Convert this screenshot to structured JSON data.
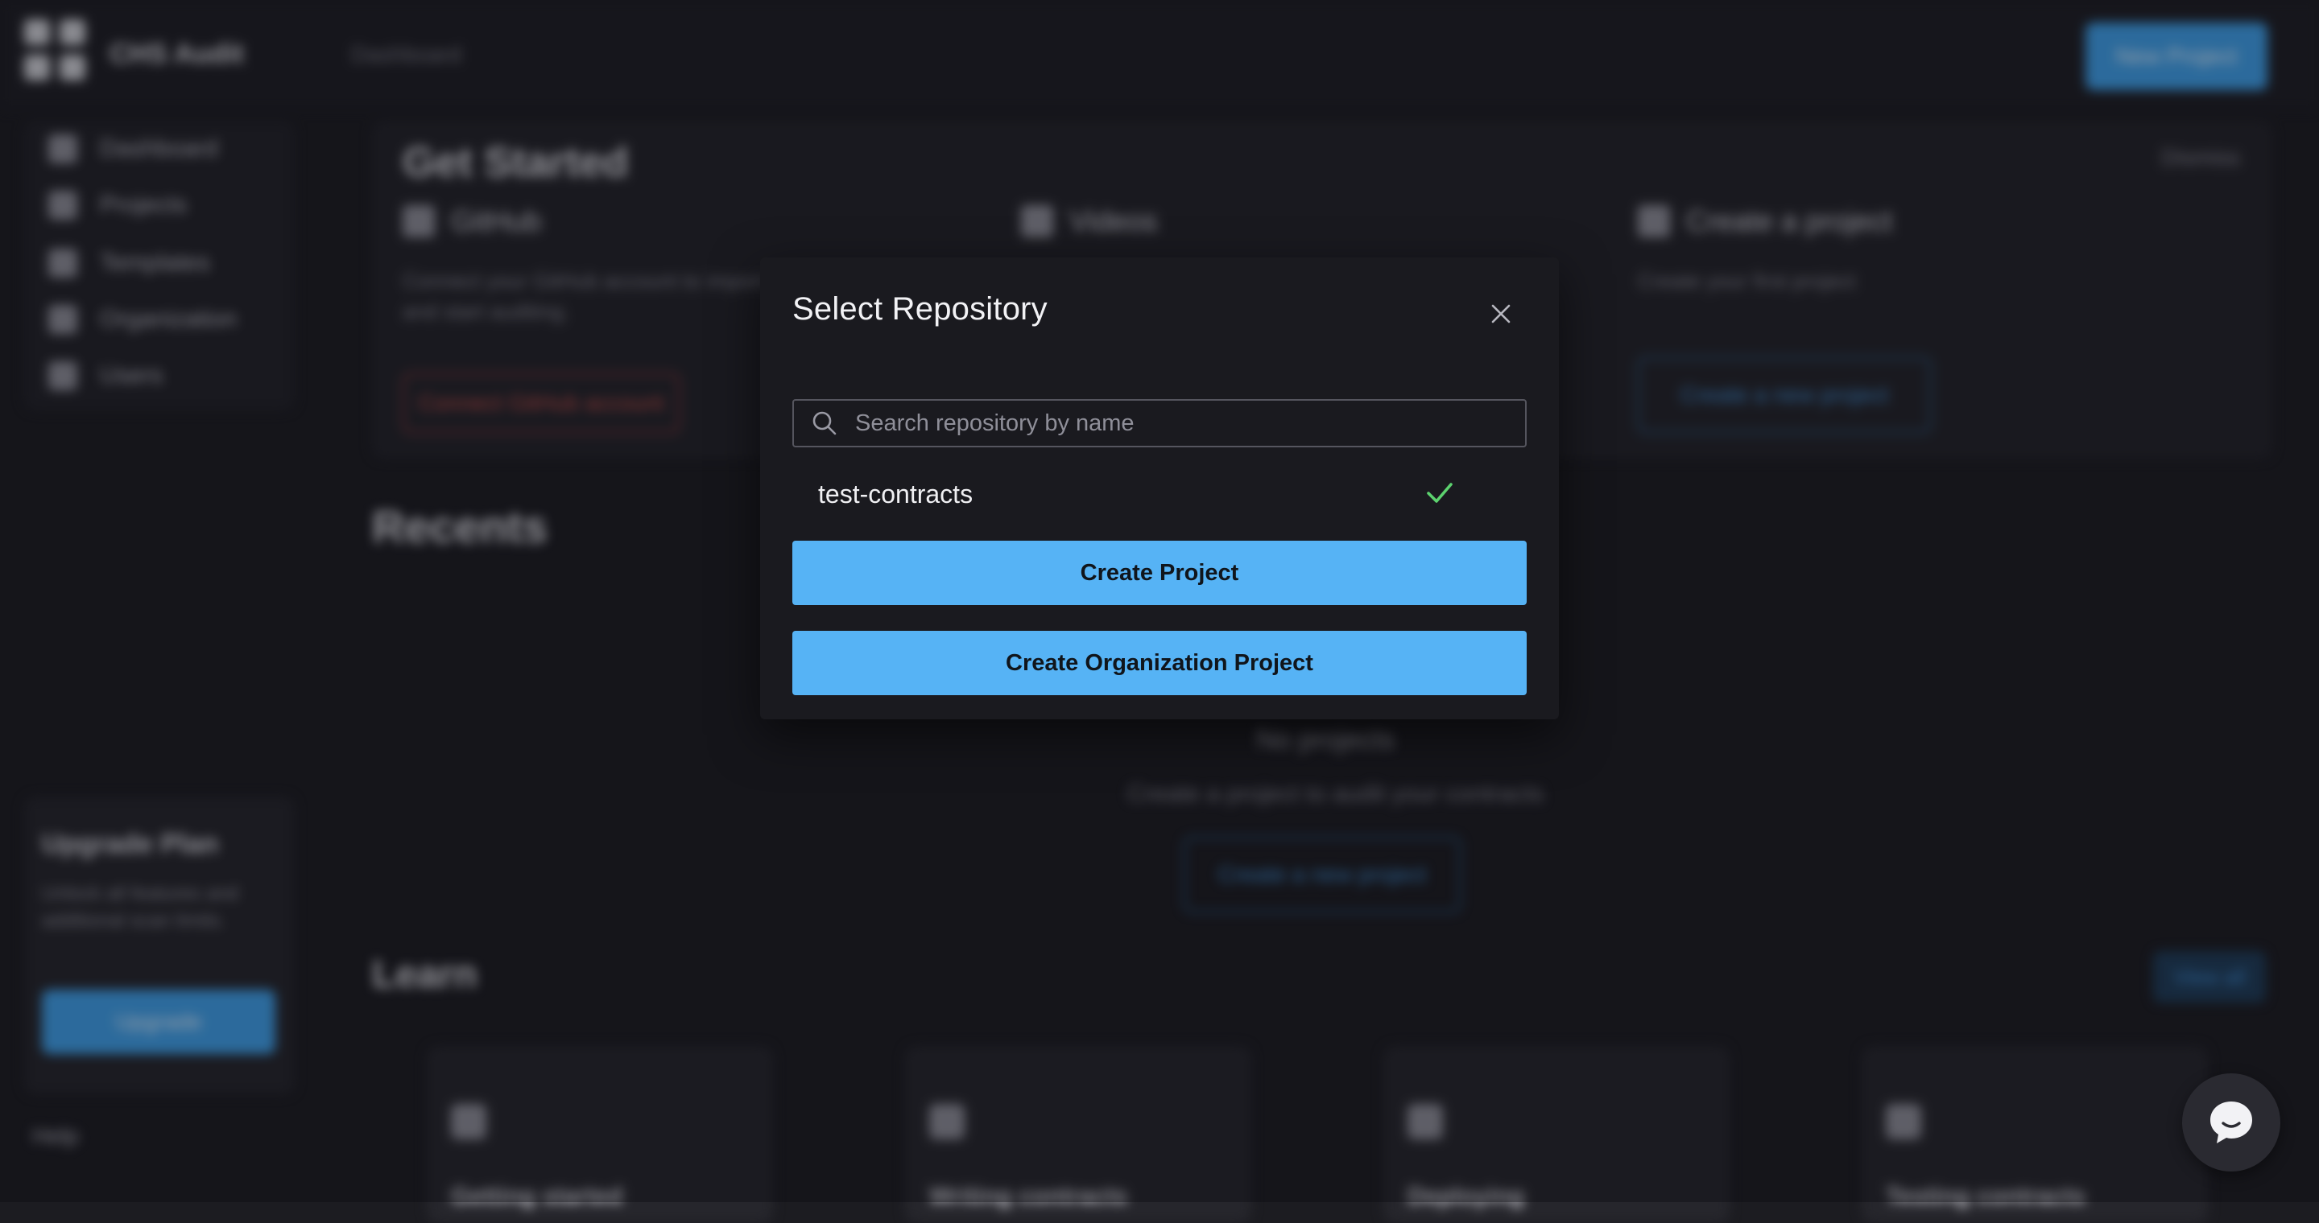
{
  "background": {
    "brand": "CHS Audit",
    "breadcrumb": "Dashboard",
    "top_button": "New Project",
    "sidebar": [
      {
        "label": "Dashboard",
        "icon": "dashboard-icon"
      },
      {
        "label": "Projects",
        "icon": "projects-icon"
      },
      {
        "label": "Templates",
        "icon": "templates-icon"
      },
      {
        "label": "Organization",
        "icon": "organization-icon"
      },
      {
        "label": "Users",
        "icon": "users-icon"
      }
    ],
    "upgrade": {
      "title": "Upgrade Plan",
      "description": "Unlock all features and additional scan limits.",
      "button": "Upgrade"
    },
    "help": "Help",
    "get_started": {
      "title": "Get Started",
      "dismiss": "Dismiss",
      "columns": [
        {
          "heading": "GitHub",
          "text": "Connect your GitHub account to import your repositories and start auditing."
        },
        {
          "heading": "Videos",
          "text": ""
        },
        {
          "heading": "Create a project",
          "text": "Create your first project"
        }
      ],
      "github_button": "Connect GitHub account",
      "project_button": "Create a new project"
    },
    "recents": {
      "title": "Recents",
      "empty_title": "No projects",
      "empty_subtitle": "Create a project to audit your contracts",
      "empty_button": "Create a new project"
    },
    "learn": {
      "title": "Learn",
      "view_all": "View all",
      "cards": [
        "Getting started",
        "Writing contracts",
        "Deploying",
        "Testing contracts"
      ]
    }
  },
  "modal": {
    "title": "Select Repository",
    "close_icon": "close-icon",
    "search": {
      "placeholder": "Search repository by name",
      "value": "",
      "icon": "search-icon"
    },
    "repositories": [
      {
        "name": "test-contracts",
        "selected": true,
        "check_icon": "check-icon",
        "check_color": "#5cd26e"
      }
    ],
    "buttons": {
      "create_project": "Create Project",
      "create_org_project": "Create Organization Project"
    },
    "accent_color": "#56b3f5"
  },
  "chat": {
    "icon": "chat-bubble-icon"
  }
}
